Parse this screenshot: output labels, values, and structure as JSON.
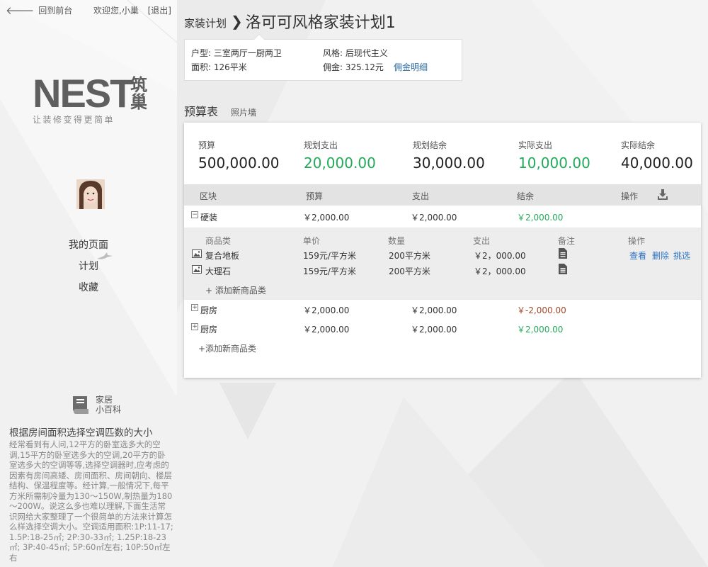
{
  "top": {
    "back_label": "回到前台",
    "welcome": "欢迎您,小巢",
    "logout": "[退出]"
  },
  "logo": {
    "main": "NEST",
    "cn": "筑巢",
    "tagline": "让装修变得更简单"
  },
  "nav": {
    "items": [
      {
        "label": "我的页面"
      },
      {
        "label": "计划"
      },
      {
        "label": "收藏"
      }
    ]
  },
  "encyclopedia": {
    "label_1": "家居",
    "label_2": "小百科"
  },
  "article": {
    "title": "根据房间面积选择空调匹数的大小",
    "body": "经常看到有人问,12平方的卧室选多大的空调,15平方的卧室选多大的空调,20平方的卧室选多大的空调等等,选择空调器时,应考虑的因素有房间高矮、房间面积、房间朝向、楼层结构、保温程度等。经计算,一般情况下,每平方米所需制冷量为130～150W,制热量为180～200W。说这么多也难以理解,下面生活常识网给大家整理了一个很简单的方法来计算怎么样选择空调大小。空调适用面积:1P:11-17; 1.5P:18-25㎡; 2P:30-33㎡; 1.25P:18-23㎡; 3P:40-45㎡; 5P:60㎡左右; 10P:50㎡左右"
  },
  "breadcrumb": {
    "parent": "家装计划",
    "sep": "❯",
    "title": "洛可可风格家装计划1"
  },
  "info": {
    "layout_label": "户型:",
    "layout_value": "三室两厅一厨两卫",
    "style_label": "风格:",
    "style_value": "后现代主义",
    "area_label": "面积:",
    "area_value": "126平米",
    "commission_label": "佣金:",
    "commission_value": "325.12元",
    "commission_link": "佣金明细"
  },
  "tabs": {
    "active": "预算表",
    "other": "照片墙"
  },
  "summary": [
    {
      "label": "预算",
      "value": "500,000.00"
    },
    {
      "label": "规划支出",
      "value": "20,000.00"
    },
    {
      "label": "规划结余",
      "value": "30,000.00"
    },
    {
      "label": "实际支出",
      "value": "10,000.00"
    },
    {
      "label": "实际结余",
      "value": "40,000.00"
    }
  ],
  "colors": {
    "green": "#22aa5a",
    "red": "#a0492a",
    "link": "#2c72c2"
  },
  "table": {
    "headers": [
      "区块",
      "预算",
      "支出",
      "结余",
      "操作"
    ],
    "rows": [
      {
        "toggle": "−",
        "name": "硬装",
        "budget": "￥2,000.00",
        "spent": "￥2,000.00",
        "balance": "￥2,000.00"
      },
      {
        "toggle": "+",
        "name": "厨房",
        "budget": "￥2,000.00",
        "spent": "￥2,000.00",
        "balance": "￥-2,000.00"
      },
      {
        "toggle": "+",
        "name": "厨房",
        "budget": "￥2,000.00",
        "spent": "￥2,000.00",
        "balance": "￥2,000.00"
      }
    ],
    "sub": {
      "headers": [
        "商品类",
        "单价",
        "数量",
        "支出",
        "备注",
        "操作"
      ],
      "rows": [
        {
          "name": "复合地板",
          "price": "159元/平方米",
          "qty": "200平方米",
          "spent": "￥2，000.00",
          "actions": [
            "查看",
            "删除",
            "挑选"
          ]
        },
        {
          "name": "大理石",
          "price": "159元/平方米",
          "qty": "200平方米",
          "spent": "￥2，000.00"
        }
      ],
      "add_label": "+ 添加新商品类"
    },
    "add_label": "+添加新商品类"
  }
}
